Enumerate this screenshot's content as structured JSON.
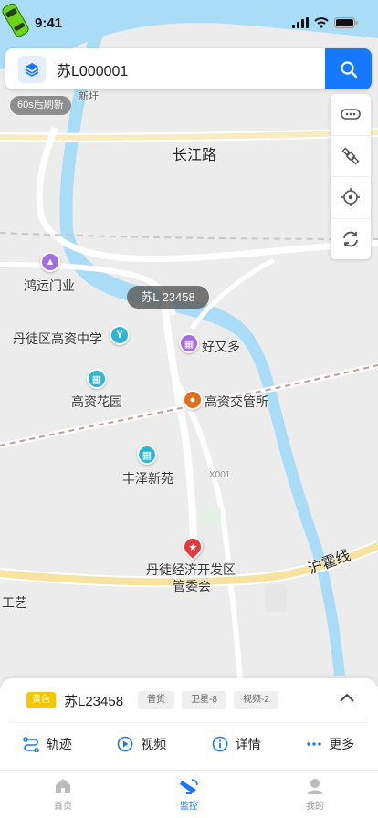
{
  "status_bar": {
    "time": "9:41"
  },
  "search": {
    "value": "苏L000001"
  },
  "refresh_badge": "60s后刷新",
  "map": {
    "labels": {
      "xinyu": "新圩",
      "changjiang_road": "长江路",
      "hongyun": "鸿运门业",
      "school": "丹徒区高资中学",
      "haoyouduo": "好又多",
      "gaozi_garden": "高资花园",
      "traffic_office": "高资交管所",
      "fengze": "丰泽新苑",
      "x001": "X001",
      "econ_zone_line1": "丹徒经济开发区",
      "econ_zone_line2": "管委会",
      "huhuo": "沪霍线",
      "gongyi": "工艺"
    }
  },
  "vehicle": {
    "tooltip": "苏L 23458"
  },
  "card": {
    "plate_color": "黄色",
    "plate": "苏L23458",
    "tags": [
      "普货",
      "卫星-8",
      "视频-2"
    ],
    "actions": {
      "track": "轨迹",
      "video": "视频",
      "details": "详情",
      "more": "更多"
    }
  },
  "tabs": {
    "home": "首页",
    "monitor": "监控",
    "mine": "我的"
  },
  "colors": {
    "accent": "#1677ff",
    "plate_yellow": "#f6c600",
    "car_green": "#6ad61a"
  }
}
